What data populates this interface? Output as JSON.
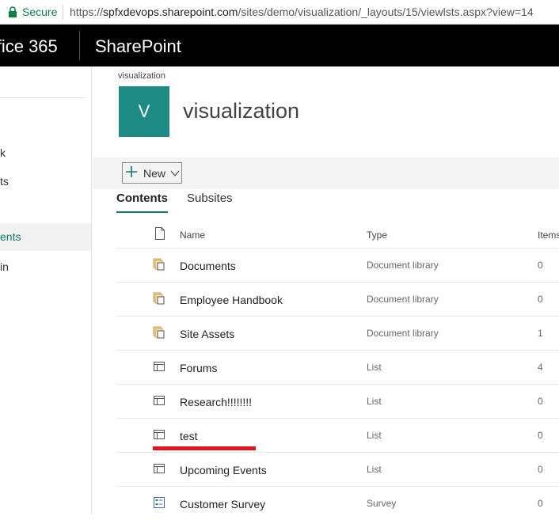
{
  "address_bar": {
    "secure_label": "Secure",
    "url_scheme": "https://",
    "url_host": "spfxdevops.sharepoint.com",
    "url_path": "/sites/demo/visualization/_layouts/15/viewlsts.aspx?view=14"
  },
  "suite_bar": {
    "brand": "ffice 365",
    "app_name": "SharePoint"
  },
  "left_nav": {
    "items": [
      "k",
      "ts",
      "ents",
      "in"
    ],
    "selected_index": 2
  },
  "site": {
    "breadcrumb": "visualization",
    "logo_letter": "V",
    "title": "visualization"
  },
  "command_bar": {
    "new_label": "New"
  },
  "tabs": {
    "contents": "Contents",
    "subsites": "Subsites"
  },
  "list": {
    "columns": {
      "name": "Name",
      "type": "Type",
      "items": "Items"
    },
    "rows": [
      {
        "icon": "document-library-icon",
        "name": "Documents",
        "type": "Document library",
        "count": "0"
      },
      {
        "icon": "document-library-icon",
        "name": "Employee Handbook",
        "type": "Document library",
        "count": "0"
      },
      {
        "icon": "document-library-icon",
        "name": "Site Assets",
        "type": "Document library",
        "count": "1"
      },
      {
        "icon": "list-icon",
        "name": "Forums",
        "type": "List",
        "count": "4"
      },
      {
        "icon": "list-icon",
        "name": "Research!!!!!!!!",
        "type": "List",
        "count": "0"
      },
      {
        "icon": "list-icon",
        "name": "test",
        "type": "List",
        "count": "0"
      },
      {
        "icon": "list-icon",
        "name": "Upcoming Events",
        "type": "List",
        "count": "0"
      },
      {
        "icon": "survey-icon",
        "name": "Customer Survey",
        "type": "Survey",
        "count": "0"
      }
    ]
  },
  "colors": {
    "accent": "#0f7b6f",
    "logo_bg": "#1e8a84",
    "suite_bg": "#000000",
    "highlight": "#e3141e"
  }
}
